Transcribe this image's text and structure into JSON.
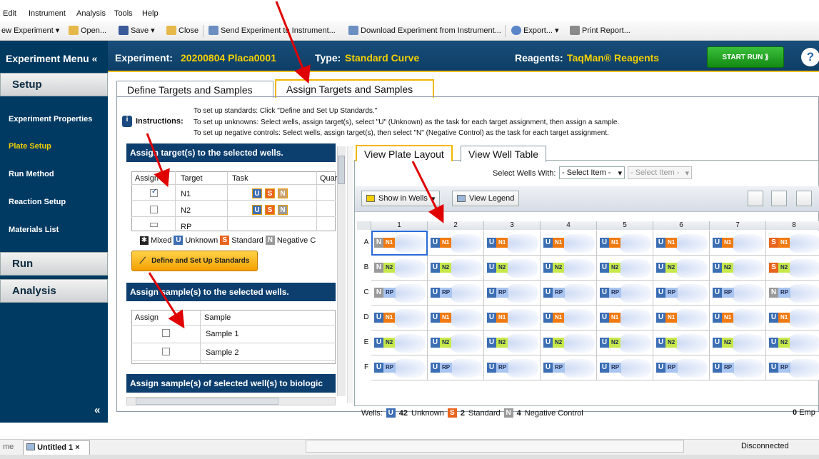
{
  "menu": [
    "Edit",
    "Instrument",
    "Analysis",
    "Tools",
    "Help"
  ],
  "toolbar": {
    "new_experiment": "ew Experiment ▾",
    "open": "Open...",
    "save": "Save ▾",
    "close": "Close",
    "send": "Send Experiment to Instrument...",
    "download": "Download Experiment from Instrument...",
    "export": "Export... ▾",
    "print": "Print Report..."
  },
  "nav": {
    "title": "Experiment Menu «",
    "setup": "Setup",
    "items": [
      "Experiment Properties",
      "Plate Setup",
      "Run Method",
      "Reaction Setup",
      "Materials List"
    ],
    "run": "Run",
    "analysis": "Analysis",
    "collapse": "«"
  },
  "header": {
    "experiment_label": "Experiment:",
    "experiment_value": "20200804 Placa0001",
    "type_label": "Type:",
    "type_value": "Standard Curve",
    "reagents_label": "Reagents:",
    "reagents_value": "TaqMan® Reagents",
    "start_run": "START RUN ⟫",
    "help": "?"
  },
  "tabs": [
    "Define Targets and Samples",
    "Assign Targets and Samples"
  ],
  "instructions": {
    "label": "Instructions:",
    "lines": [
      "To set up standards: Click \"Define and Set Up Standards.\"",
      "To set up unknowns: Select wells, assign target(s), select \"U\" (Unknown) as the task for each target assignment, then assign a sample.",
      "To set up negative controls: Select wells, assign target(s), then select \"N\" (Negative Control) as the task for each target assignment."
    ]
  },
  "targets_panel": {
    "title": "Assign target(s) to the selected wells.",
    "headers": [
      "Assign",
      "Target",
      "Task",
      "Quar"
    ],
    "rows": [
      {
        "target": "N1",
        "checked": true
      },
      {
        "target": "N2",
        "checked": false
      },
      {
        "target": "RP",
        "checked": false
      }
    ],
    "task_letters": [
      "U",
      "S",
      "N"
    ],
    "legend": {
      "mixed": "Mixed",
      "unknown": "Unknown",
      "standard": "Standard",
      "negative": "Negative C"
    },
    "define_button": "Define and Set Up Standards"
  },
  "samples_panel": {
    "title": "Assign sample(s) to the selected wells.",
    "headers": [
      "Assign",
      "Sample"
    ],
    "rows": [
      "Sample 1",
      "Sample 2"
    ]
  },
  "bio_panel": {
    "title": "Assign sample(s) of selected well(s) to biologic"
  },
  "plate": {
    "tabs": [
      "View Plate Layout",
      "View Well Table"
    ],
    "select_label": "Select Wells With:",
    "select1": "- Select Item -",
    "select2": "- Select Item -",
    "show_in_wells": "Show in Wells",
    "view_legend": "View Legend",
    "columns": [
      "1",
      "2",
      "3",
      "4",
      "5",
      "6",
      "7",
      "8"
    ],
    "rows": [
      "A",
      "B",
      "C",
      "D",
      "E",
      "F"
    ],
    "wells": [
      [
        [
          "N",
          "N1"
        ],
        [
          "U",
          "N1"
        ],
        [
          "U",
          "N1"
        ],
        [
          "U",
          "N1"
        ],
        [
          "U",
          "N1"
        ],
        [
          "U",
          "N1"
        ],
        [
          "U",
          "N1"
        ],
        [
          "S",
          "N1"
        ]
      ],
      [
        [
          "N",
          "N2"
        ],
        [
          "U",
          "N2"
        ],
        [
          "U",
          "N2"
        ],
        [
          "U",
          "N2"
        ],
        [
          "U",
          "N2"
        ],
        [
          "U",
          "N2"
        ],
        [
          "U",
          "N2"
        ],
        [
          "S",
          "N2"
        ]
      ],
      [
        [
          "N",
          "RP"
        ],
        [
          "U",
          "RP"
        ],
        [
          "U",
          "RP"
        ],
        [
          "U",
          "RP"
        ],
        [
          "U",
          "RP"
        ],
        [
          "U",
          "RP"
        ],
        [
          "U",
          "RP"
        ],
        [
          "N",
          "RP"
        ]
      ],
      [
        [
          "U",
          "N1"
        ],
        [
          "U",
          "N1"
        ],
        [
          "U",
          "N1"
        ],
        [
          "U",
          "N1"
        ],
        [
          "U",
          "N1"
        ],
        [
          "U",
          "N1"
        ],
        [
          "U",
          "N1"
        ],
        [
          "U",
          "N1"
        ]
      ],
      [
        [
          "U",
          "N2"
        ],
        [
          "U",
          "N2"
        ],
        [
          "U",
          "N2"
        ],
        [
          "U",
          "N2"
        ],
        [
          "U",
          "N2"
        ],
        [
          "U",
          "N2"
        ],
        [
          "U",
          "N2"
        ],
        [
          "U",
          "N2"
        ]
      ],
      [
        [
          "U",
          "RP"
        ],
        [
          "U",
          "RP"
        ],
        [
          "U",
          "RP"
        ],
        [
          "U",
          "RP"
        ],
        [
          "U",
          "RP"
        ],
        [
          "U",
          "RP"
        ],
        [
          "U",
          "RP"
        ],
        [
          "U",
          "RP"
        ]
      ]
    ],
    "summary": {
      "label": "Wells:",
      "unknown_count": "42",
      "unknown_label": "Unknown",
      "standard_count": "2",
      "standard_label": "Standard",
      "negative_count": "4",
      "negative_label": "Negative Control",
      "empty_count": "0",
      "empty_label": "Emp"
    }
  },
  "doc_tabs": [
    "me",
    "Untitled 1 ×"
  ],
  "status": "Disconnected",
  "colors": {
    "unknown": "#3c6eb4",
    "standard": "#e8641e",
    "negative": "#9a9a9a",
    "n1": "#f07a10",
    "n2": "#c7e84a",
    "rp": "#a8c4f0",
    "accent": "#f2b800",
    "header": "#0e3e66"
  }
}
